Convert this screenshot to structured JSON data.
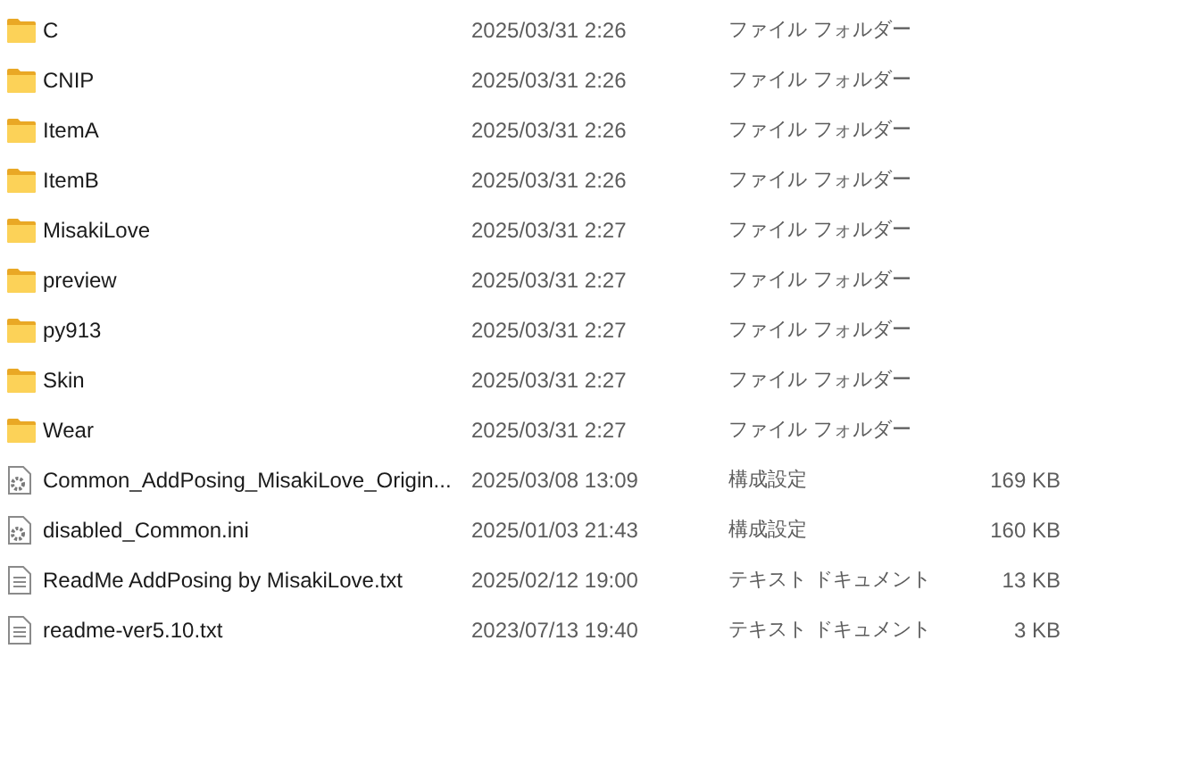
{
  "files": [
    {
      "kind": "folder",
      "name": "C",
      "date": "2025/03/31 2:26",
      "type": "ファイル フォルダー"
    },
    {
      "kind": "folder",
      "name": "CNIP",
      "date": "2025/03/31 2:26",
      "type": "ファイル フォルダー"
    },
    {
      "kind": "folder",
      "name": "ItemA",
      "date": "2025/03/31 2:26",
      "type": "ファイル フォルダー"
    },
    {
      "kind": "folder",
      "name": "ItemB",
      "date": "2025/03/31 2:26",
      "type": "ファイル フォルダー"
    },
    {
      "kind": "folder",
      "name": "MisakiLove",
      "date": "2025/03/31 2:27",
      "type": "ファイル フォルダー"
    },
    {
      "kind": "folder",
      "name": "preview",
      "date": "2025/03/31 2:27",
      "type": "ファイル フォルダー"
    },
    {
      "kind": "folder",
      "name": "py913",
      "date": "2025/03/31 2:27",
      "type": "ファイル フォルダー"
    },
    {
      "kind": "folder",
      "name": "Skin",
      "date": "2025/03/31 2:27",
      "type": "ファイル フォルダー"
    },
    {
      "kind": "folder",
      "name": "Wear",
      "date": "2025/03/31 2:27",
      "type": "ファイル フォルダー"
    },
    {
      "kind": "config",
      "name": "Common_AddPosing_MisakiLove_Origin...",
      "date": "2025/03/08 13:09",
      "type": "構成設定",
      "size": "169 KB"
    },
    {
      "kind": "config",
      "name": "disabled_Common.ini",
      "date": "2025/01/03 21:43",
      "type": "構成設定",
      "size": "160 KB"
    },
    {
      "kind": "text",
      "name": "ReadMe AddPosing by MisakiLove.txt",
      "date": "2025/02/12 19:00",
      "type": "テキスト ドキュメント",
      "size": "13 KB"
    },
    {
      "kind": "text",
      "name": "readme-ver5.10.txt",
      "date": "2023/07/13 19:40",
      "type": "テキスト ドキュメント",
      "size": "3 KB"
    }
  ]
}
